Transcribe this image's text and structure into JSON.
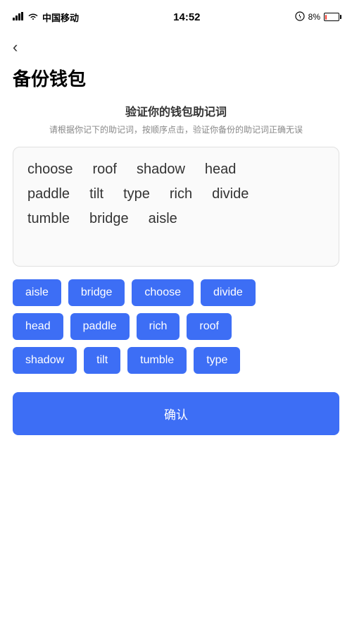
{
  "statusBar": {
    "carrier": "中国移动",
    "time": "14:52",
    "battery": "8%"
  },
  "back": {
    "label": "‹"
  },
  "pageTitle": "备份钱包",
  "section": {
    "title": "验证你的钱包助记词",
    "desc": "请根据你记下的助记词，按顺序点击，验证你备份的助记词正确无误"
  },
  "displayWords": [
    [
      "choose",
      "roof",
      "shadow",
      "head"
    ],
    [
      "paddle",
      "tilt",
      "type",
      "rich",
      "divide"
    ],
    [
      "tumble",
      "bridge",
      "aisle"
    ]
  ],
  "chipRows": [
    [
      "aisle",
      "bridge",
      "choose",
      "divide"
    ],
    [
      "head",
      "paddle",
      "rich",
      "roof"
    ],
    [
      "shadow",
      "tilt",
      "tumble",
      "type"
    ]
  ],
  "confirmButton": {
    "label": "确认"
  }
}
